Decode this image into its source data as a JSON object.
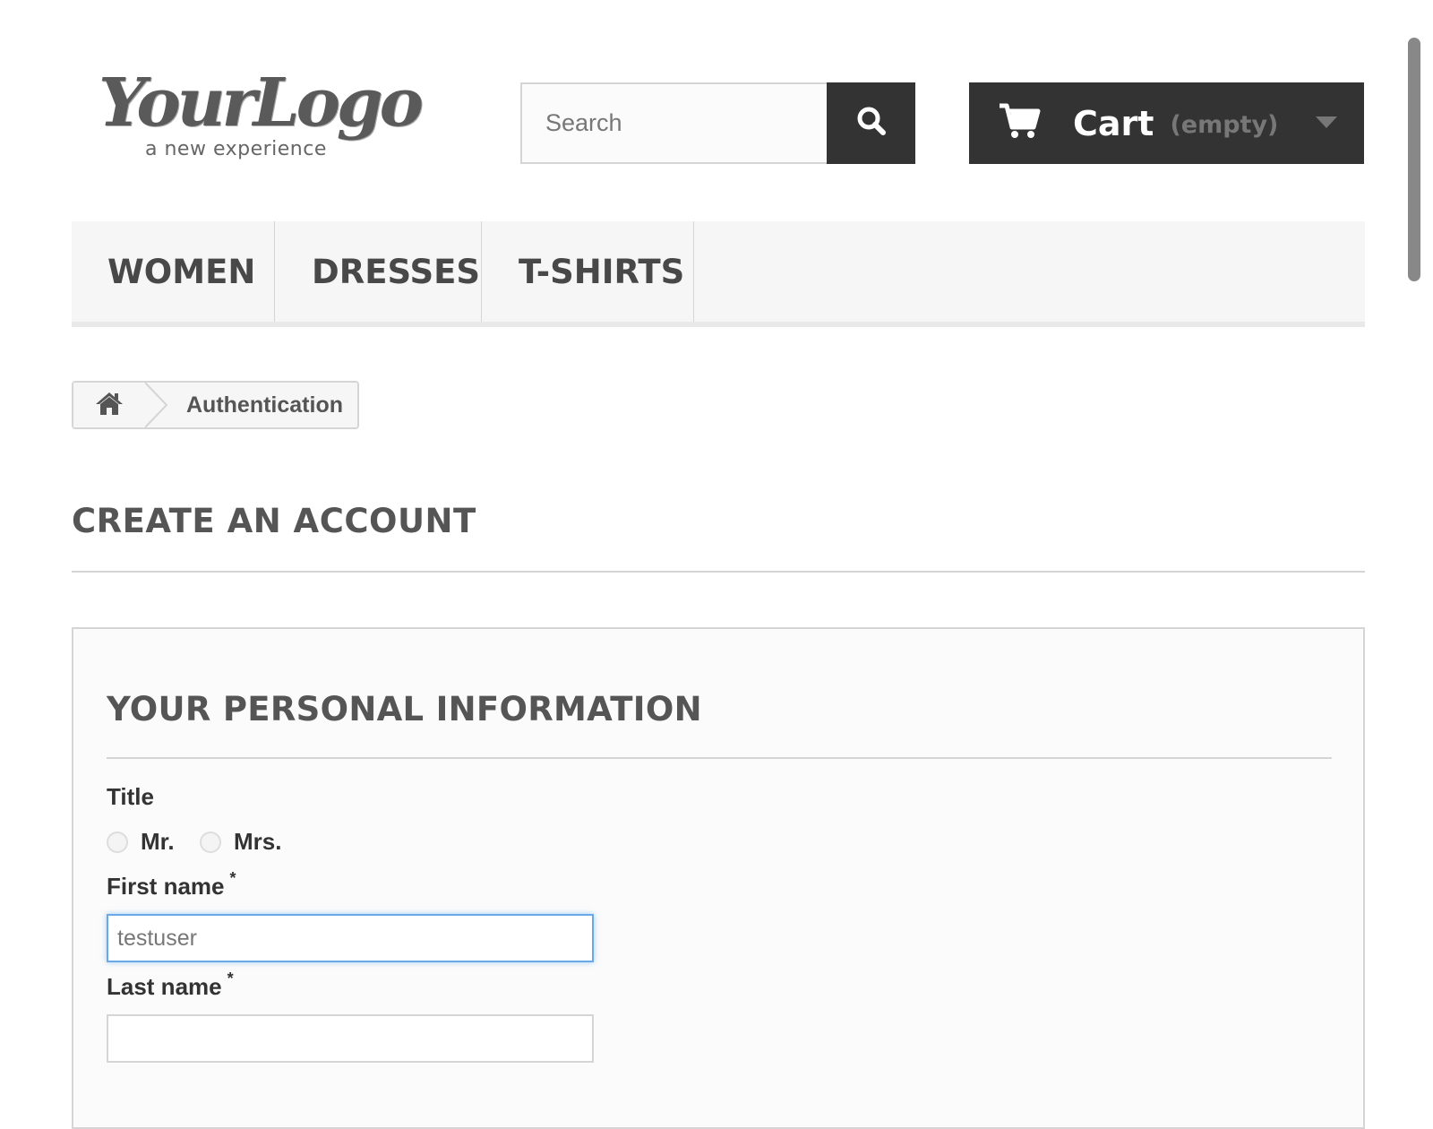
{
  "header": {
    "logo": {
      "main": "YourLogo",
      "tagline": "a new experience"
    },
    "search": {
      "placeholder": "Search",
      "button_icon": "search-icon"
    },
    "cart": {
      "label": "Cart",
      "status": "(empty)",
      "icon": "cart-icon",
      "caret_icon": "caret-down-icon"
    }
  },
  "menu": {
    "items": [
      {
        "label": "WOMEN"
      },
      {
        "label": "DRESSES"
      },
      {
        "label": "T-SHIRTS"
      }
    ]
  },
  "breadcrumb": {
    "home_icon": "home-icon",
    "current": "Authentication"
  },
  "page": {
    "heading": "CREATE AN ACCOUNT",
    "form": {
      "section_title": "YOUR PERSONAL INFORMATION",
      "title_label": "Title",
      "title_options": [
        "Mr.",
        "Mrs."
      ],
      "first_name_label": "First name",
      "first_name_value": "testuser",
      "last_name_label": "Last name",
      "last_name_value": "",
      "required_marker": "*"
    }
  },
  "colors": {
    "dark": "#333333",
    "menu_bg": "#f6f6f6",
    "border": "#d6d4d4",
    "focus": "#6aa8e6"
  }
}
